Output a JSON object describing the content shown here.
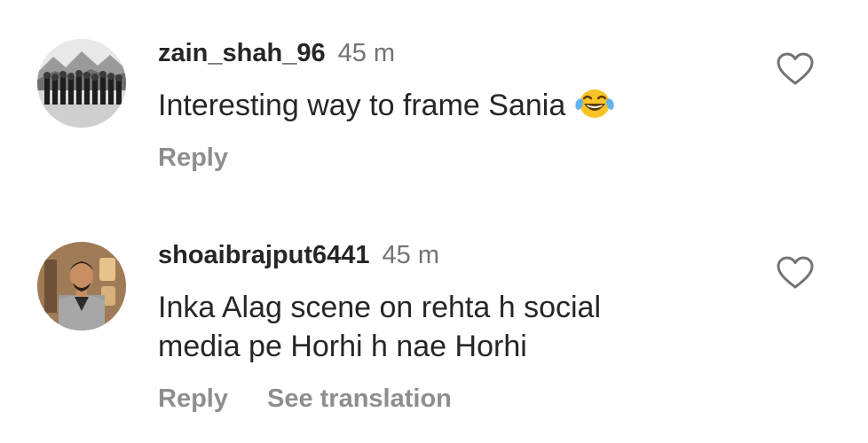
{
  "comments": [
    {
      "username": "zain_shah_96",
      "time": "45 m",
      "text": "Interesting way to frame Sania",
      "emoji": "face-with-tears-of-joy",
      "actions": {
        "reply": "Reply"
      },
      "like_icon": "heart-outline-icon"
    },
    {
      "username": "shoaibrajput6441",
      "time": "45 m",
      "text_line1": "Inka Alag scene on rehta h social",
      "text_line2": "media pe Horhi h nae Horhi",
      "actions": {
        "reply": "Reply",
        "translate": "See translation"
      },
      "like_icon": "heart-outline-icon"
    }
  ],
  "colors": {
    "username": "#262626",
    "body_text": "#262626",
    "secondary": "#737373",
    "action": "#8e8e8e"
  }
}
